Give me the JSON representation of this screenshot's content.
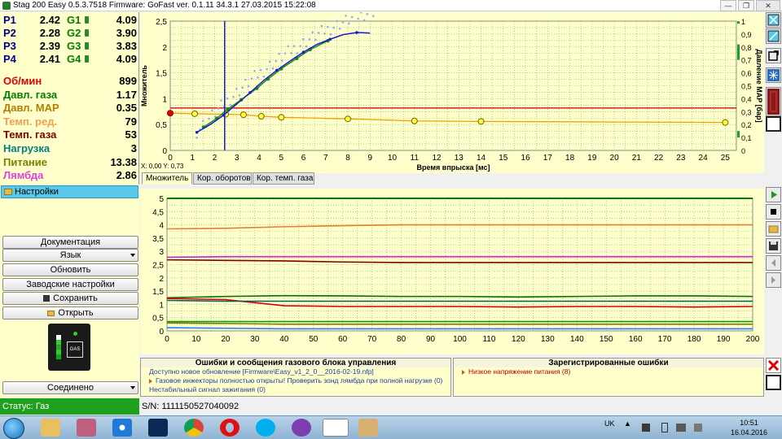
{
  "window": {
    "title": "Stag 200 Easy 0.5.3.7518 Firmware: GoFast  ver. 0.1.11  34.3.1  27.03.2015 15:22:08",
    "minimize": "—",
    "restore": "❐",
    "close": "✕"
  },
  "injectors": [
    {
      "p_label": "P1",
      "p_value": "2.42",
      "g_label": "G1",
      "g_value": "4.09"
    },
    {
      "p_label": "P2",
      "p_value": "2.28",
      "g_label": "G2",
      "g_value": "3.90"
    },
    {
      "p_label": "P3",
      "p_value": "2.39",
      "g_label": "G3",
      "g_value": "3.83"
    },
    {
      "p_label": "P4",
      "p_value": "2.41",
      "g_label": "G4",
      "g_value": "4.09"
    }
  ],
  "params": [
    {
      "label": "Об/мин",
      "value": "899",
      "color": "#e00000"
    },
    {
      "label": "Давл. газа",
      "value": "1.17",
      "color": "#008000"
    },
    {
      "label": "Давл. MAP",
      "value": "0.35",
      "color": "#b08000"
    },
    {
      "label": "Темп. ред.",
      "value": "79",
      "color": "#f0a050"
    },
    {
      "label": "Темп. газа",
      "value": "53",
      "color": "#800000"
    },
    {
      "label": "Нагрузка",
      "value": "3",
      "color": "#008080"
    },
    {
      "label": "Питание",
      "value": "13.38",
      "color": "#808000"
    },
    {
      "label": "Лямбда",
      "value": "2.86",
      "color": "#e040e0"
    }
  ],
  "menu": {
    "settings": "Настройки",
    "documentation": "Документация",
    "language": "Язык",
    "update": "Обновить",
    "factory": "Заводские настройки",
    "save": "Сохранить",
    "open": "Открыть",
    "connection": "Соединено",
    "device_label": "GAS"
  },
  "status": {
    "state": "Статус: Газ",
    "serial": "S/N: 1111150527040092"
  },
  "chart_top": {
    "coords": "X: 0,00  Y: 0,73",
    "tabs": [
      "Множитель",
      "Кор. оборотов",
      "Кор. темп. газа"
    ]
  },
  "messages": {
    "left_title": "Ошибки и сообщения газового блока управления",
    "left_items": [
      "Доступно новое обновление [Firmware\\Easy_v1_2_0__2016-02-19.nfp]",
      "Газовое инжекторы полностью открыты! Проверить зонд лямбда при полной нагрузке (0)",
      "Нестабильный сигнал зажигания (0)"
    ],
    "right_title": "Зарегистрированные ошибки",
    "right_items": [
      "Низкое напряжение питания (8)"
    ]
  },
  "taskbar": {
    "lang": "UK",
    "time": "10:51",
    "date": "16.04.2016"
  },
  "chart_data": [
    {
      "type": "scatter",
      "xlabel": "Время впрыска [мс]",
      "ylabel": "Множитель",
      "y2label": "Давление MAP [бар]",
      "xlim": [
        0,
        25.5
      ],
      "ylim": [
        0,
        2.5
      ],
      "y2lim": [
        0,
        1
      ],
      "xticks": [
        0,
        1,
        2,
        3,
        4,
        5,
        6,
        7,
        8,
        9,
        10,
        11,
        12,
        13,
        14,
        15,
        16,
        17,
        18,
        19,
        20,
        21,
        22,
        23,
        24,
        25
      ],
      "yticks": [
        "0",
        "0,5",
        "1",
        "1,5",
        "2",
        "2,5"
      ],
      "y2ticks": [
        "0",
        "0,1",
        "0,2",
        "0,3",
        "0,4",
        "0,5",
        "0,6",
        "0,7",
        "0,8",
        "0,9",
        "1"
      ],
      "cursor_x": 2.45,
      "multiplier_level": 0.82,
      "series": [
        {
          "color": "#1a1ad0",
          "x": [
            1.2,
            1.8,
            2.4,
            3.0,
            3.6,
            4.2,
            4.8,
            5.4,
            6.0,
            6.6,
            7.2,
            7.8,
            8.4,
            9.0
          ],
          "y": [
            0.35,
            0.5,
            0.68,
            0.9,
            1.12,
            1.35,
            1.55,
            1.73,
            1.9,
            2.05,
            2.15,
            2.24,
            2.28,
            2.27
          ]
        },
        {
          "color": "#f0a000",
          "x": [
            0,
            1.1,
            2.5,
            3.3,
            4.1,
            5.0,
            8.0,
            11.0,
            14.0,
            25.0
          ],
          "y": [
            0.72,
            0.71,
            0.7,
            0.69,
            0.66,
            0.64,
            0.61,
            0.57,
            0.56,
            0.54
          ]
        }
      ],
      "scatter_green": {
        "x": [
          1.5,
          2.1,
          2.6,
          3.2,
          3.9,
          4.4,
          5.0,
          5.7,
          6.3,
          7.1
        ],
        "y": [
          0.45,
          0.62,
          0.8,
          0.98,
          1.2,
          1.38,
          1.58,
          1.78,
          1.95,
          2.12
        ]
      }
    },
    {
      "type": "line",
      "xlim": [
        0,
        200
      ],
      "ylim": [
        0,
        5
      ],
      "xticks": [
        0,
        10,
        20,
        30,
        40,
        50,
        60,
        70,
        80,
        90,
        100,
        110,
        120,
        130,
        140,
        150,
        160,
        170,
        180,
        190,
        200
      ],
      "yticks": [
        "0",
        "0,5",
        "1",
        "1,5",
        "2",
        "2,5",
        "3",
        "3,5",
        "4",
        "4,5",
        "5"
      ],
      "series": [
        {
          "color": "#008000",
          "y": [
            5,
            5,
            5,
            5,
            5,
            5,
            5,
            5,
            5,
            5,
            5
          ]
        },
        {
          "color": "#e08030",
          "y": [
            3.85,
            3.87,
            3.93,
            3.97,
            4.0,
            4.0,
            4.0,
            4.0,
            4.0,
            4.0,
            4.0
          ]
        },
        {
          "color": "#d020d0",
          "y": [
            2.78,
            2.8,
            2.8,
            2.8,
            2.8,
            2.8,
            2.8,
            2.8,
            2.8,
            2.8,
            2.8
          ]
        },
        {
          "color": "#800000",
          "y": [
            2.68,
            2.66,
            2.64,
            2.6,
            2.58,
            2.58,
            2.58,
            2.58,
            2.58,
            2.58,
            2.58
          ]
        },
        {
          "color": "#007000",
          "y": [
            1.25,
            1.3,
            1.33,
            1.32,
            1.3,
            1.3,
            1.28,
            1.3,
            1.32,
            1.32,
            1.3
          ]
        },
        {
          "color": "#e00000",
          "y": [
            1.22,
            1.18,
            0.95,
            0.92,
            0.92,
            0.92,
            0.9,
            0.92,
            0.92,
            0.9,
            0.92
          ]
        },
        {
          "color": "#006060",
          "y": [
            1.15,
            1.12,
            1.12,
            1.12,
            1.12,
            1.12,
            1.12,
            1.12,
            1.12,
            1.12,
            1.12
          ]
        },
        {
          "color": "#00a000",
          "y": [
            0.35,
            0.35,
            0.35,
            0.35,
            0.35,
            0.35,
            0.35,
            0.35,
            0.35,
            0.35,
            0.35
          ]
        },
        {
          "color": "#808000",
          "y": [
            0.3,
            0.28,
            0.25,
            0.25,
            0.25,
            0.25,
            0.25,
            0.25,
            0.25,
            0.25,
            0.25
          ]
        },
        {
          "color": "#2080ff",
          "y": [
            0.12,
            0.1,
            0.08,
            0.08,
            0.08,
            0.08,
            0.08,
            0.08,
            0.08,
            0.08,
            0.08
          ]
        }
      ]
    }
  ]
}
